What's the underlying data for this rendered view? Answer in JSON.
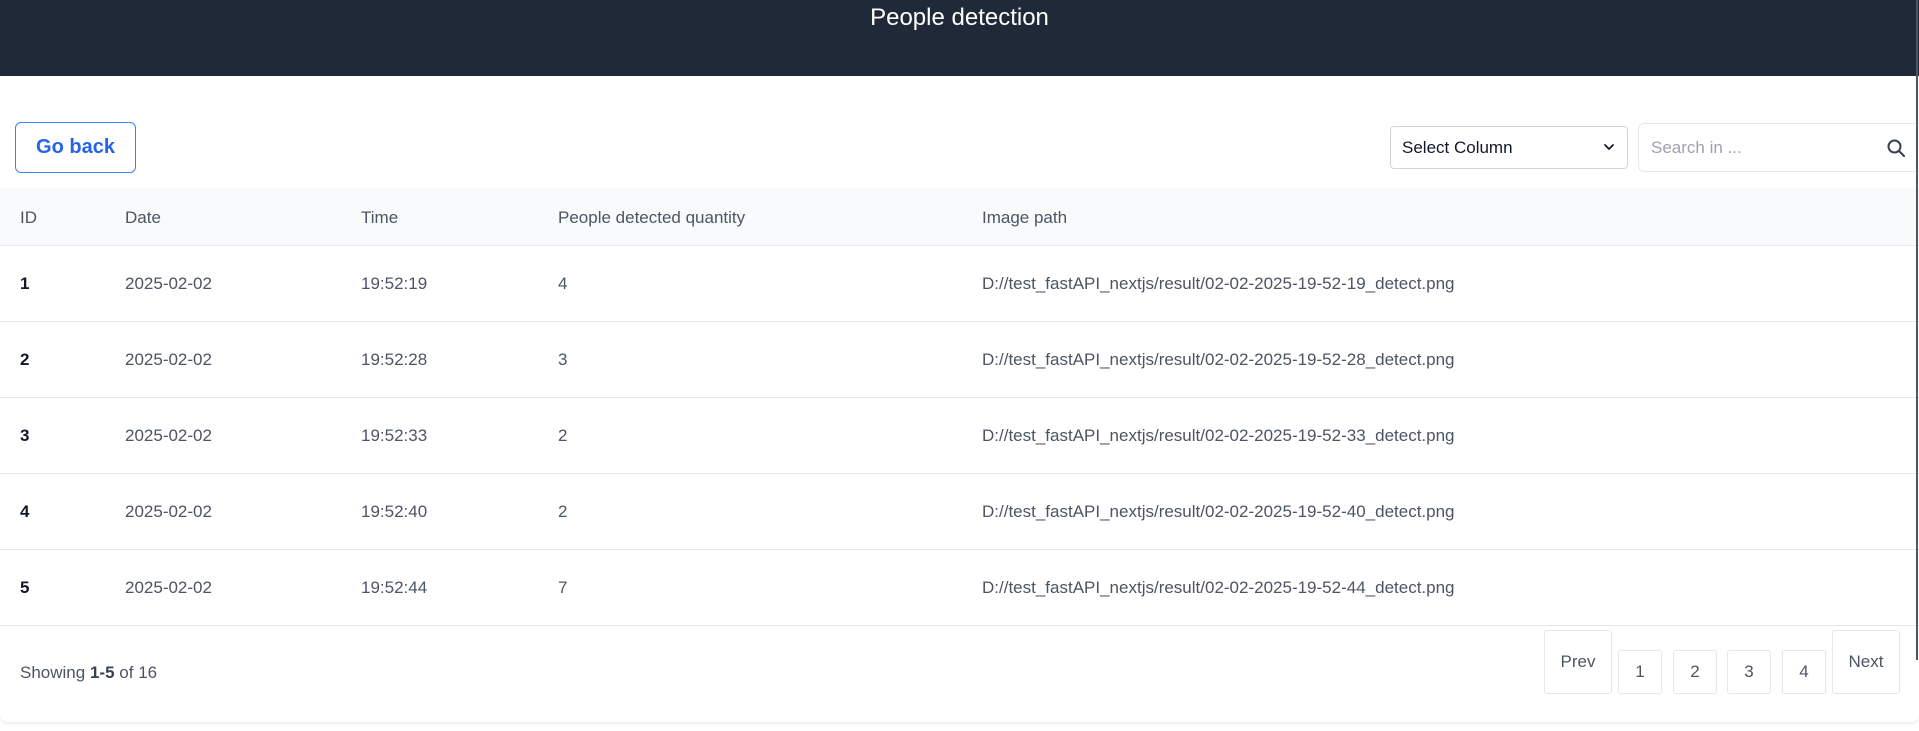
{
  "header": {
    "title": "People detection"
  },
  "toolbar": {
    "go_back_label": "Go back",
    "select_column_value": "Select Column",
    "search_placeholder": "Search in ..."
  },
  "table": {
    "columns": [
      "ID",
      "Date",
      "Time",
      "People detected quantity",
      "Image path"
    ],
    "rows": [
      {
        "id": "1",
        "date": "2025-02-02",
        "time": "19:52:19",
        "qty": "4",
        "path": "D://test_fastAPI_nextjs/result/02-02-2025-19-52-19_detect.png"
      },
      {
        "id": "2",
        "date": "2025-02-02",
        "time": "19:52:28",
        "qty": "3",
        "path": "D://test_fastAPI_nextjs/result/02-02-2025-19-52-28_detect.png"
      },
      {
        "id": "3",
        "date": "2025-02-02",
        "time": "19:52:33",
        "qty": "2",
        "path": "D://test_fastAPI_nextjs/result/02-02-2025-19-52-33_detect.png"
      },
      {
        "id": "4",
        "date": "2025-02-02",
        "time": "19:52:40",
        "qty": "2",
        "path": "D://test_fastAPI_nextjs/result/02-02-2025-19-52-40_detect.png"
      },
      {
        "id": "5",
        "date": "2025-02-02",
        "time": "19:52:44",
        "qty": "7",
        "path": "D://test_fastAPI_nextjs/result/02-02-2025-19-52-44_detect.png"
      }
    ]
  },
  "pagination": {
    "showing_prefix": "Showing",
    "showing_range": "1-5",
    "showing_of": "of",
    "showing_total": "16",
    "prev_label": "Prev",
    "pages": [
      "1",
      "2",
      "3",
      "4"
    ],
    "next_label": "Next"
  },
  "icons": {
    "search": "search-icon",
    "select_arrow": "chevron-down-icon"
  },
  "colors": {
    "header_bg": "#1f2937",
    "accent": "#2563eb"
  }
}
